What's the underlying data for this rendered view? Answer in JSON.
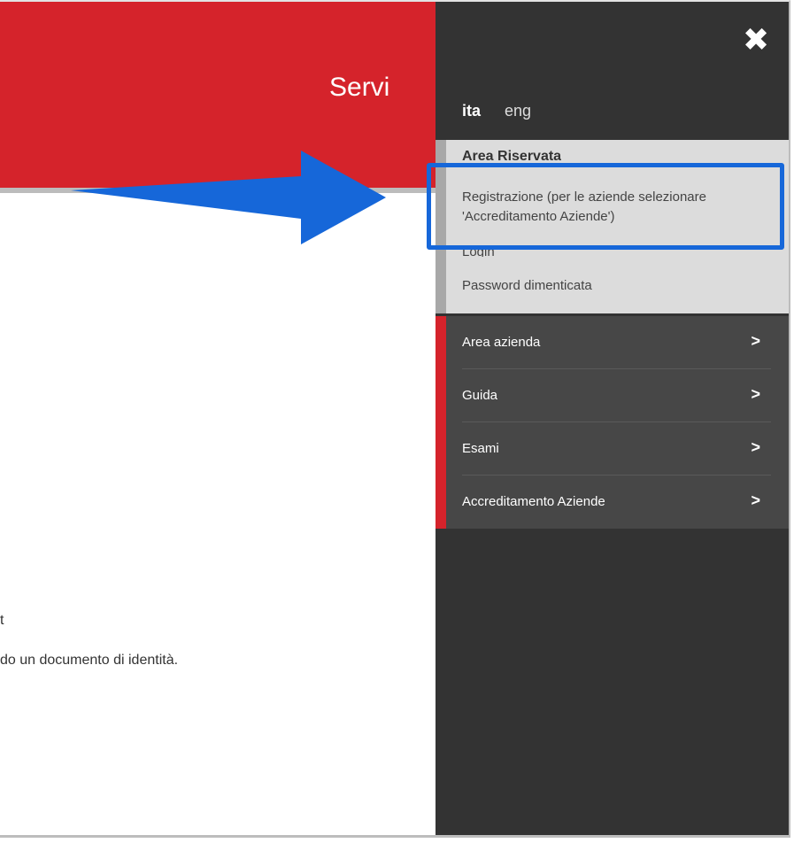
{
  "page": {
    "header_title": "Servi",
    "body_text_1": "t",
    "body_text_2": "do un documento di identità."
  },
  "menu": {
    "close_icon": "close-icon",
    "languages": {
      "ita": "ita",
      "eng": "eng"
    },
    "reserved_area": {
      "title": "Area Riservata",
      "registration": "Registrazione (per le aziende selezionare 'Accreditamento Aziende')",
      "login": "Login",
      "forgot_password": "Password dimenticata"
    },
    "items": [
      {
        "label": "Area azienda"
      },
      {
        "label": "Guida"
      },
      {
        "label": "Esami"
      },
      {
        "label": "Accreditamento Aziende"
      }
    ]
  },
  "colors": {
    "header_red": "#d5232b",
    "menu_dark": "#333333",
    "annotation_blue": "#1667d9"
  }
}
